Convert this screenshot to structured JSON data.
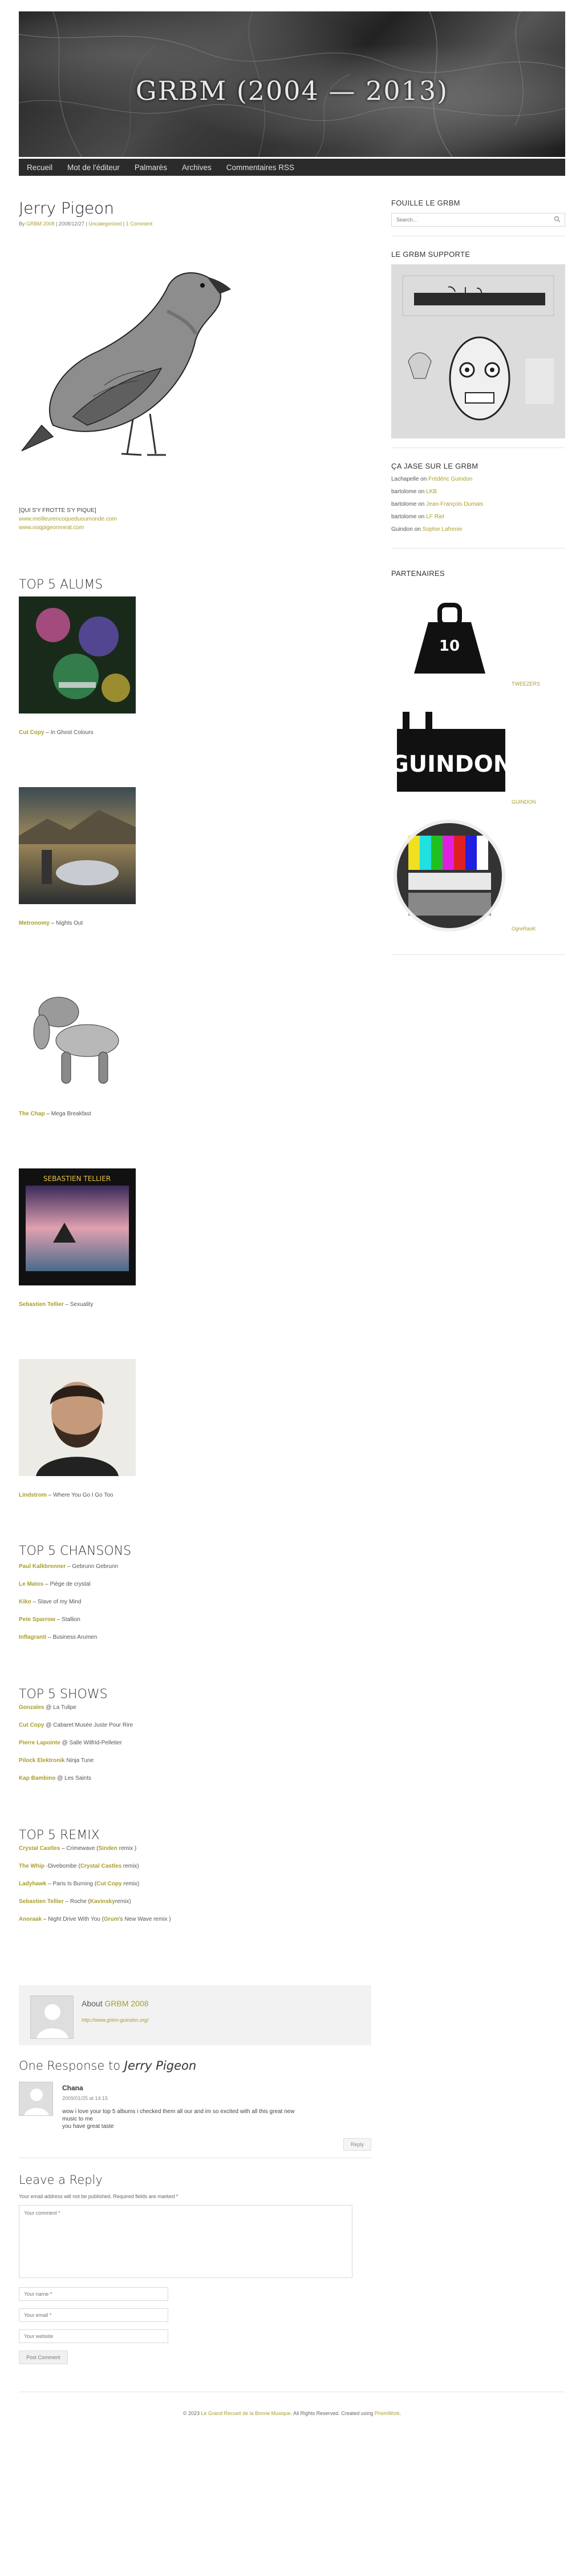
{
  "site": {
    "title": "GRBM (2004 — 2013)"
  },
  "nav": [
    "Recueil",
    "Mot de l'éditeur",
    "Palmarès",
    "Archives",
    "Commentaires RSS"
  ],
  "post": {
    "title": "Jerry Pigeon",
    "meta_by": "By",
    "author": "GRBM 2008",
    "meta_date": "| 2008/12/27 |",
    "category": "Uncategorized",
    "meta_sep": " | ",
    "comments_link": "1 Comment",
    "caption": "[QUI S'Y FROTTE S'Y PIQUE]",
    "link1": "www.meilleurencoqueduoumonde.com",
    "link2": "www.ooqpigeonmeat.com"
  },
  "albums": {
    "title": "TOP 5 ALUMS",
    "items": [
      {
        "artist": "Cut Copy",
        "title": "In Ghost Colours"
      },
      {
        "artist": "Metronomy",
        "title": "Nights Out"
      },
      {
        "artist": "The Chap",
        "title": "Mega Breakfast"
      },
      {
        "artist": "Sebastien Tellier",
        "title": "Sexuality"
      },
      {
        "artist": "Lindstrom",
        "title": "Where You Go I Go Too"
      }
    ],
    "sep": " – "
  },
  "songs": {
    "title": "TOP 5 CHANSONS",
    "items": [
      {
        "artist": "Paul Kalkbrenner",
        "rest": "Gebrunn Gebrunn"
      },
      {
        "artist": "Le Matos",
        "rest": "Piège de crystal"
      },
      {
        "artist": "Kiko",
        "rest": "Slave of my Mind"
      },
      {
        "artist": "Pete Sparrow",
        "rest": "Stallion"
      },
      {
        "artist": "Inflagranti",
        "rest": "Business Arumen"
      }
    ]
  },
  "shows": {
    "title": "TOP 5 SHOWS",
    "items": [
      {
        "artist": "Gonzales",
        "rest": "@ La Tulipe"
      },
      {
        "artist": "Cut Copy",
        "rest": "@ Cabaret Musée Juste Pour Rire"
      },
      {
        "artist": "Pierre Lapointe",
        "rest": "@ Salle Wilfrid-Pelletier"
      },
      {
        "artist": "Pilock Elektronik",
        "rest": "Ninja Tune"
      },
      {
        "artist": "Kap Bambino",
        "rest": "@ Les Saints"
      }
    ]
  },
  "remix": {
    "title": "TOP 5 REMIX",
    "items": [
      {
        "a": "Crystal Castles",
        "b": " – Crimewave (",
        "c": "Sinden",
        "d": " remix )"
      },
      {
        "a": "The Whip",
        "b": " -Divebombe (",
        "c": "Crystal Castles",
        "d": " remix)"
      },
      {
        "a": "Ladyhawk",
        "b": " – Paris Is Burning (",
        "c": "Cut Copy",
        "d": " remix)"
      },
      {
        "a": "Sebastien Tellier",
        "b": " – Roche (",
        "c": "Kavinsky",
        "d": "remix)"
      },
      {
        "a": "Anoraak",
        "b": " – Night Drive With You (",
        "c": "Grum",
        "d": "'s New Wave remix )"
      }
    ]
  },
  "author_box": {
    "about": "About",
    "name": "GRBM 2008",
    "url": "http://www.grbm-guindon.org/"
  },
  "responses": {
    "prefix": "One Response to",
    "title": "Jerry Pigeon"
  },
  "comment": {
    "author": "Chana",
    "date": "2009/01/25 at 14:15",
    "text1": "wow i love your top 5 albums i checked them all our and im so excited with all this great new",
    "text2": "music to me",
    "text3": "you have great taste",
    "reply": "Reply"
  },
  "reply_form": {
    "title": "Leave a Reply",
    "notes": "Your email address will not be published. Required fields are marked",
    "req": "*",
    "comment_placeholder": "Your comment *",
    "name_placeholder": "Your name *",
    "email_placeholder": "Your email *",
    "website_placeholder": "Your website",
    "submit": "Post Comment"
  },
  "sidebar": {
    "search_title": "FOUILLE LE GRBM",
    "search_placeholder": "Search...",
    "support_title": "LE GRBM SUPPORTE",
    "recent_title": "ÇA JASE SUR LE GRBM",
    "recent": [
      {
        "who": "Lachapelle",
        "on": "on",
        "post": "Frédéric Guindon"
      },
      {
        "who": "bartolome",
        "on": "on",
        "post": "LKB"
      },
      {
        "who": "bartolome",
        "on": "on",
        "post": "Jean-François Dumais"
      },
      {
        "who": "bartolome",
        "on": "on",
        "post": "LF Riel"
      },
      {
        "who": "Guindon",
        "on": "on",
        "post": "Sophie Lafrenie"
      }
    ],
    "partners_title": "PARTENAIRES",
    "partners": [
      "TWEEZERS",
      "GUINDON",
      "OgreRaoK"
    ]
  },
  "footer": {
    "pre": "© 2023",
    "site": "Le Grand Recueil de la Bonne Musique",
    "mid": ". All Rights Reserved. Created using",
    "theme": "PrismWork",
    "end": "."
  },
  "colors": {
    "accent": "#a99e2a",
    "nav": "#2b2b2b"
  }
}
